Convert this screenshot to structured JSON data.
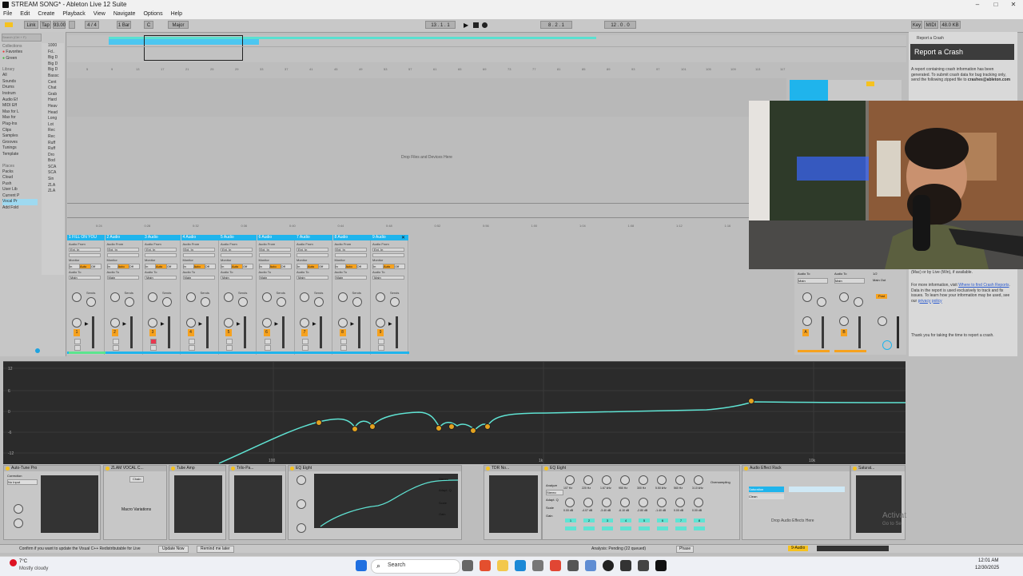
{
  "window": {
    "title": "STREAM SONG* - Ableton Live 12 Suite",
    "minimize": "–",
    "maximize": "□",
    "close": "✕"
  },
  "menu": [
    "File",
    "Edit",
    "Create",
    "Playback",
    "View",
    "Navigate",
    "Options",
    "Help"
  ],
  "transport": {
    "link": "Link",
    "tap": "Tap",
    "tempo": "93.00",
    "signature": "4 / 4",
    "quantize": "1 Bar",
    "key": "C",
    "scale": "Major",
    "position": "13 . 1 . 1",
    "loop_start": "8 . 2 . 1",
    "loop_length": "12 . 0 . 0",
    "key_label": "Key",
    "midi_label": "MIDI",
    "cpu": "48.0 KB"
  },
  "browser": {
    "search_placeholder": "Search (Ctrl + F)",
    "collections_header": "Collections",
    "collections": [
      "Favorites",
      "Green"
    ],
    "library_header": "Library",
    "library": [
      "All",
      "Sounds",
      "Drums",
      "Instrum",
      "Audio Ef",
      "MIDI Eff",
      "Max for L",
      "Max for",
      "Plug-Ins",
      "Clips",
      "Samples",
      "Grooves",
      "Tunings",
      "Template"
    ],
    "places_header": "Places",
    "places": [
      "Packs",
      "Cloud",
      "Push",
      "User Lib",
      "Current P",
      "Vocal Pr",
      "Add Fold"
    ],
    "names": [
      "1000",
      "Fd..",
      "Big D",
      "Big D",
      "Big D",
      "Bassc",
      "Cent",
      "Chat",
      "Grab",
      "Hard",
      "Heav",
      "Head",
      "Long",
      "Lot",
      "Rec",
      "Rec",
      "Ruff",
      "Ruff",
      "Dro",
      "Bod",
      "SCA",
      "SCA",
      "Sin",
      "ZLA",
      "ZLA"
    ]
  },
  "arrangement": {
    "drop_message": "Drop Files and Devices Here",
    "top_ticks": [
      "5",
      "9",
      "13",
      "17",
      "21",
      "25",
      "29",
      "33",
      "37",
      "41",
      "45",
      "49",
      "53",
      "57",
      "61",
      "65",
      "69",
      "73",
      "77",
      "81",
      "85",
      "89",
      "93",
      "97",
      "101",
      "105",
      "109",
      "113",
      "117"
    ],
    "bottom_ticks": [
      "0:24",
      "0:28",
      "0:32",
      "0:36",
      "0:40",
      "0:44",
      "0:48",
      "0:52",
      "0:56",
      "1:00",
      "1:04",
      "1:08",
      "1:12",
      "1:16"
    ]
  },
  "mixer": {
    "tracks": [
      {
        "name": "1 FILL ON YOU",
        "number": "1"
      },
      {
        "name": "2 Audio",
        "number": "2"
      },
      {
        "name": "3 Audio",
        "number": "3"
      },
      {
        "name": "4 Audio",
        "number": "4"
      },
      {
        "name": "5 Audio",
        "number": "5"
      },
      {
        "name": "6 Audio",
        "number": "6"
      },
      {
        "name": "7 Audio",
        "number": "7"
      },
      {
        "name": "8 Audio",
        "number": "8"
      },
      {
        "name": "9 Audio",
        "number": "9"
      }
    ],
    "labels": {
      "audio_from": "Audio From",
      "ext_in": "Ext. In",
      "monitor": "Monitor",
      "in": "In",
      "auto": "Auto",
      "off": "Off",
      "audio_to": "Audio To",
      "main": "Main",
      "sends": "Sends"
    },
    "return_labels": {
      "audio_to": "Audio To",
      "main": "Main",
      "ab": "A",
      "b": "B",
      "post": "Post",
      "cue_out": "Cue Out",
      "main_out": "Main Out"
    },
    "cue_value": "1/2"
  },
  "crash_dialog": {
    "heading_small": "Report a Crash",
    "heading": "Report a Crash",
    "p1": "A report containing crash information has been generated. To submit crash data for bug tracking only, send the following zipped file to",
    "email": "crashes@ableton.com",
    "p_mid": "(Mac) or by Live (Win), if available.",
    "p2a": "For more information, visit",
    "link": "Where to find Crash Reports",
    "p2b": ". Data in the report is used exclusively to track and fix issues. To learn how your information may be used, see our",
    "privacy": "privacy policy",
    "p3": "Thank you for taking the time to report a crash."
  },
  "eq_view": {
    "db_labels": [
      "12",
      "6",
      "0",
      "-6",
      "-12"
    ],
    "freq_labels": [
      "100",
      "1k",
      "10k"
    ]
  },
  "devices": [
    {
      "name": "Auto-Tune Pro",
      "pitch_label": "Correction",
      "value": "No Input"
    },
    {
      "name": "ZLAM VOCAL C...",
      "macro_label": "Macro Variations",
      "chip": "Chain"
    },
    {
      "name": "Tube Amp"
    },
    {
      "name": "Trilo-Pa..."
    },
    {
      "name": "EQ Eight",
      "adapt": "Adapt. Q",
      "scale": "Scale",
      "gain": "Gain",
      "stereo": "Stereo",
      "values": [
        "12",
        "6",
        "0",
        "-6",
        "-12"
      ]
    },
    {
      "name": "TDR No..."
    },
    {
      "name": "EQ Eight",
      "analyze": "Analyze",
      "mode": "Stereo",
      "adapt": "Adapt. Q",
      "scale": "Scale",
      "gain": "Gain",
      "oversample": "Oversampling",
      "bands": [
        "1",
        "2",
        "3",
        "4",
        "5",
        "6",
        "7",
        "8"
      ],
      "freq_values": [
        "107 Hz",
        "220 Hz",
        "1.67 kHz",
        "950 Hz",
        "300 Hz",
        "5.50 kHz",
        "560 Hz",
        "3.10 kHz"
      ],
      "gain_values": [
        "0.00 dB",
        "-4.07 dB",
        "-3.40 dB",
        "-6.10 dB",
        "-2.80 dB",
        "-1.40 dB",
        "0.00 dB",
        "0.00 dB"
      ]
    },
    {
      "name": "Audio Effect Rack",
      "chains": [
        "Saturation",
        "Clean"
      ],
      "drop": "Drop Audio Effects Here"
    },
    {
      "name": "Saturat..."
    }
  ],
  "status": {
    "message": "Confirm if you want to update the Visual C++ Redistributable for Live",
    "btn_update": "Update Now",
    "btn_later": "Remind me later",
    "analysis": "Analysis: Pending (22 queued)",
    "phase": "Phase",
    "track": "9-Audio"
  },
  "watermark": {
    "line1": "Activat",
    "line2": "Go to Se"
  },
  "taskbar": {
    "weather_temp": "7°C",
    "weather_desc": "Mostly cloudy",
    "search": "Search",
    "time": "12:01 AM",
    "date": "12/30/2025"
  }
}
